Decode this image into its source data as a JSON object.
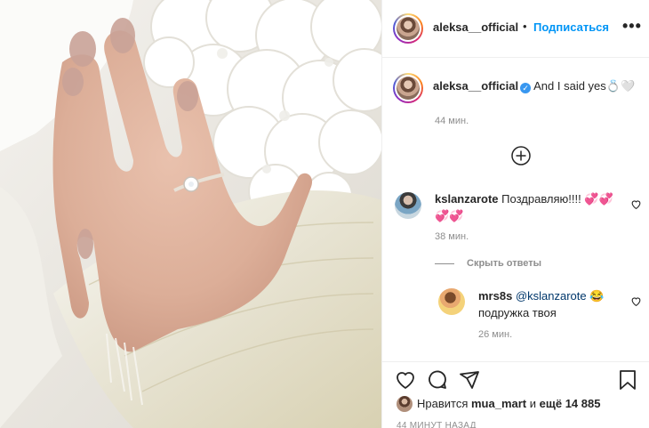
{
  "post": {
    "author": "aleksa__official",
    "follow_label": "Подписаться",
    "dot": "•",
    "more_label": "•••",
    "caption": "And I said yes💍🤍",
    "caption_time": "44 мин."
  },
  "comments": [
    {
      "user": "kslanzarote",
      "text": "Поздравляю!!!! 💞💞💞💞",
      "time": "38 мин.",
      "hide_replies_label": "Скрыть ответы"
    },
    {
      "user": "mrs8s",
      "mention": "@kslanzarote",
      "text": " 😂 подружка твоя",
      "time": "26 мин."
    }
  ],
  "actions": {
    "icons": [
      "heart-icon",
      "comment-icon",
      "share-icon",
      "bookmark-icon"
    ]
  },
  "likes": {
    "prefix": "Нравится",
    "user": "mua_mart",
    "middle": "и",
    "rest": "ещё 14 885"
  },
  "timestamp": "44 МИНУТ НАЗАД",
  "colors": {
    "accent": "#0095f6",
    "text": "#262626",
    "muted": "#8e8e8e",
    "verified": "#3897f0"
  }
}
